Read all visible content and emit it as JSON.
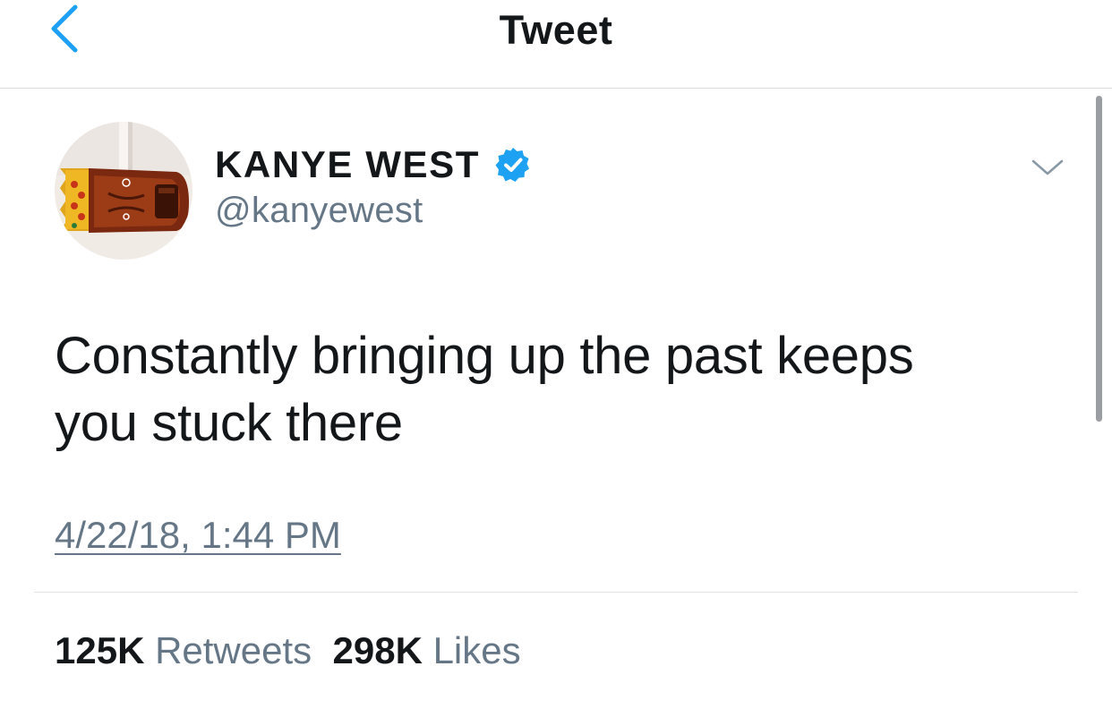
{
  "nav": {
    "title": "Tweet",
    "back_icon": "chevron-left-icon",
    "accent_color": "#1da1f2"
  },
  "user": {
    "display_name": "KANYE WEST",
    "handle": "@kanyewest",
    "verified": true,
    "verified_icon": "verified-badge-icon",
    "avatar_icon": "avatar"
  },
  "tweet": {
    "text_line1": "Constantly bringing up the past keeps",
    "text_line2": "you stuck there",
    "timestamp": "4/22/18, 1:44 PM",
    "menu_icon": "chevron-down-icon"
  },
  "stats": {
    "retweets_count": "125K",
    "retweets_label": "Retweets",
    "likes_count": "298K",
    "likes_label": "Likes"
  },
  "colors": {
    "text_primary": "#14171a",
    "text_secondary": "#657786",
    "divider": "#e1e4e7",
    "verified": "#1da1f2"
  }
}
